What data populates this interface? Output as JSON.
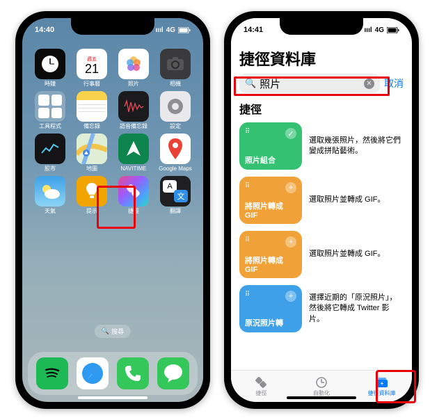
{
  "left": {
    "status": {
      "time": "14:40",
      "net": "4G"
    },
    "apps": [
      {
        "name": "時鐘",
        "i": "clock"
      },
      {
        "name": "行事曆",
        "i": "cal",
        "wk": "週五",
        "day": "21"
      },
      {
        "name": "照片",
        "i": "photos"
      },
      {
        "name": "相機",
        "i": "cam"
      },
      {
        "name": "工具程式",
        "i": "util"
      },
      {
        "name": "備忘錄",
        "i": "notes"
      },
      {
        "name": "語音備忘錄",
        "i": "voice"
      },
      {
        "name": "設定",
        "i": "sett"
      },
      {
        "name": "股市",
        "i": "stocks"
      },
      {
        "name": "地圖",
        "i": "maps"
      },
      {
        "name": "NAVITIME",
        "i": "navi"
      },
      {
        "name": "Google Maps",
        "i": "gmaps"
      },
      {
        "name": "天氣",
        "i": "wea"
      },
      {
        "name": "提示",
        "i": "tips"
      },
      {
        "name": "捷徑",
        "i": "sc"
      },
      {
        "name": "翻譯",
        "i": "trans"
      }
    ],
    "search": "搜尋",
    "dock": [
      {
        "i": "spotify"
      },
      {
        "i": "safari"
      },
      {
        "i": "phone"
      },
      {
        "i": "msg"
      }
    ]
  },
  "right": {
    "status": {
      "time": "14:41",
      "net": "4G"
    },
    "title": "捷徑資料庫",
    "search": {
      "value": "照片",
      "cancel": "取消"
    },
    "section": "捷徑",
    "cards": [
      {
        "label": "照片組合",
        "color": "#34c172",
        "desc": "選取幾張照片，然後將它們變成拼貼藝術。",
        "action": "check"
      },
      {
        "label": "將照片轉成 GIF",
        "color": "#f0a238",
        "desc": "選取照片並轉成 GIF。",
        "action": "plus"
      },
      {
        "label": "將照片轉成 GIF",
        "color": "#f0a238",
        "desc": "選取照片並轉成 GIF。",
        "action": "plus"
      },
      {
        "label": "原況照片轉",
        "color": "#3ea0e8",
        "desc": "選擇近期的「原況照片」，然後將它轉成 Twitter 影片。",
        "action": "plus"
      }
    ],
    "tabs": [
      {
        "label": "捷徑",
        "active": false
      },
      {
        "label": "自動化",
        "active": false
      },
      {
        "label": "捷徑資料庫",
        "active": true
      }
    ]
  }
}
